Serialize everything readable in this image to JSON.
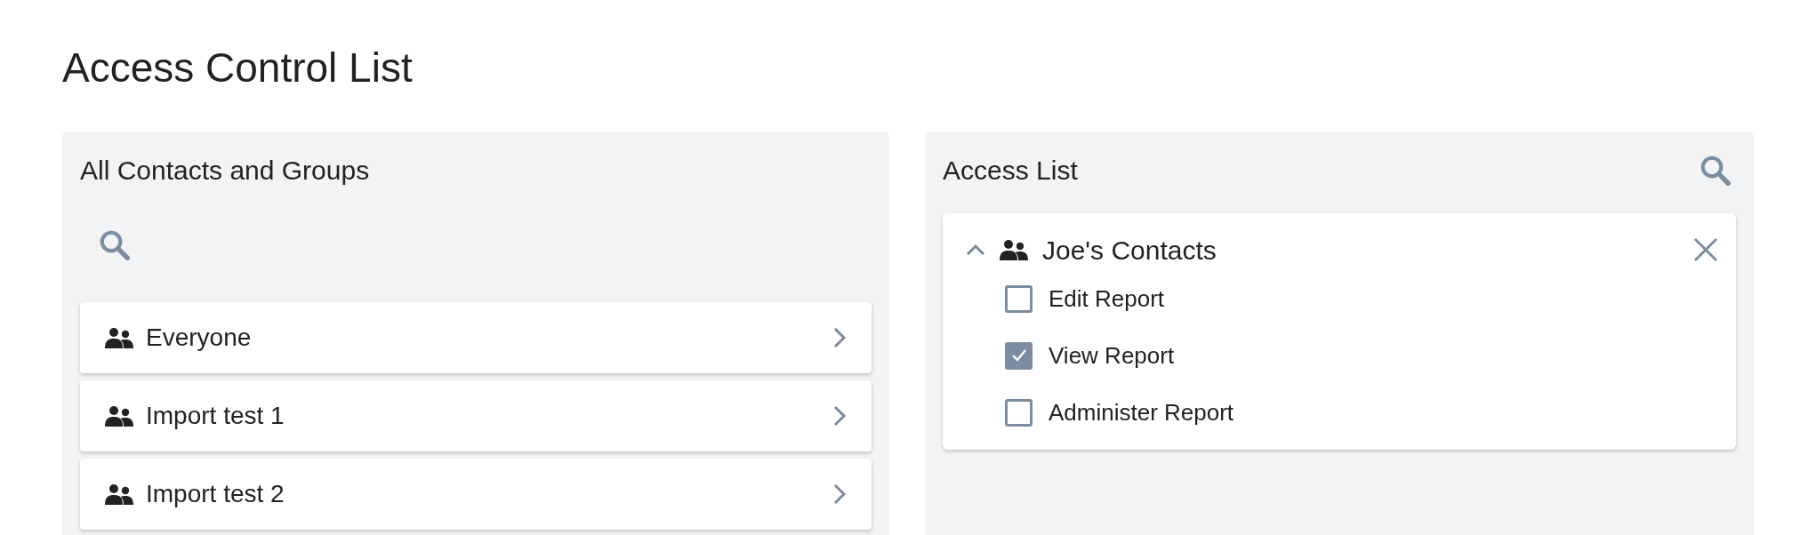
{
  "page_title": "Access Control List",
  "contacts_panel": {
    "title": "All Contacts and Groups",
    "items": [
      {
        "label": "Everyone"
      },
      {
        "label": "Import test 1"
      },
      {
        "label": "Import test 2"
      }
    ]
  },
  "access_panel": {
    "title": "Access List",
    "entries": [
      {
        "name": "Joe's Contacts",
        "expanded": true,
        "permissions": [
          {
            "label": "Edit Report",
            "checked": false
          },
          {
            "label": "View Report",
            "checked": true
          },
          {
            "label": "Administer Report",
            "checked": false
          }
        ]
      }
    ]
  }
}
